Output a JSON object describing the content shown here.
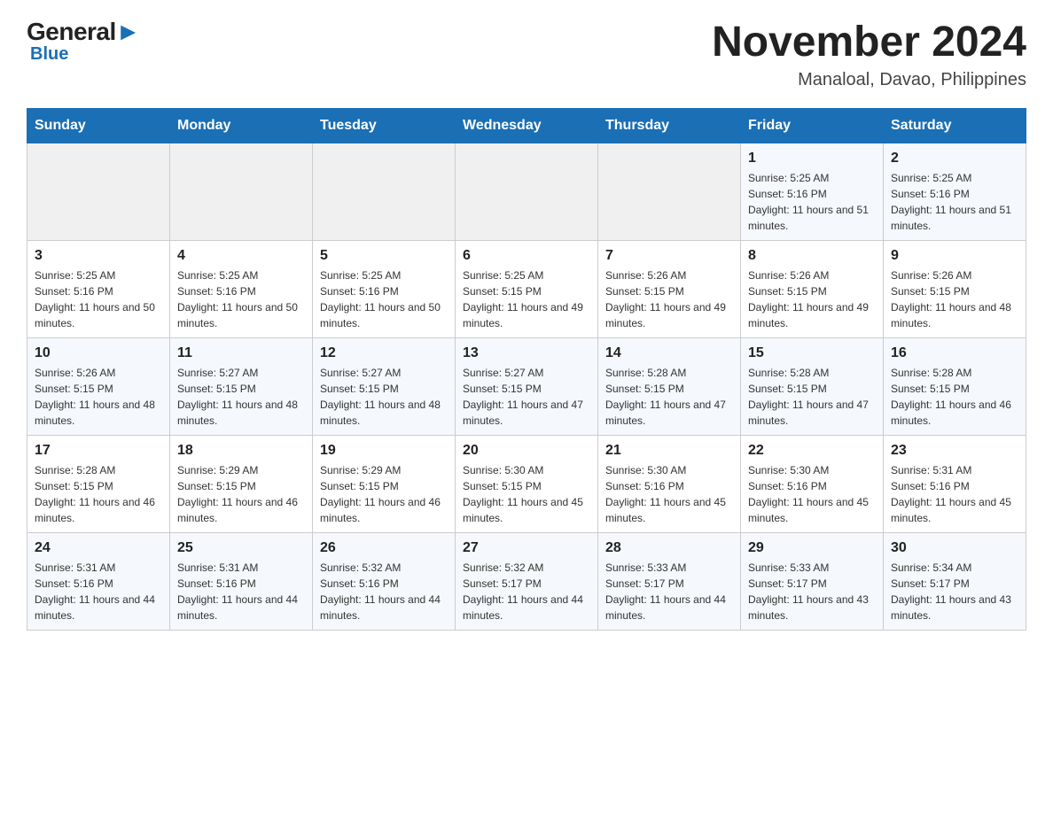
{
  "header": {
    "logo_general": "General",
    "logo_blue": "Blue",
    "month_title": "November 2024",
    "location": "Manaloal, Davao, Philippines"
  },
  "days_of_week": [
    "Sunday",
    "Monday",
    "Tuesday",
    "Wednesday",
    "Thursday",
    "Friday",
    "Saturday"
  ],
  "weeks": [
    [
      {
        "day": "",
        "info": ""
      },
      {
        "day": "",
        "info": ""
      },
      {
        "day": "",
        "info": ""
      },
      {
        "day": "",
        "info": ""
      },
      {
        "day": "",
        "info": ""
      },
      {
        "day": "1",
        "info": "Sunrise: 5:25 AM\nSunset: 5:16 PM\nDaylight: 11 hours and 51 minutes."
      },
      {
        "day": "2",
        "info": "Sunrise: 5:25 AM\nSunset: 5:16 PM\nDaylight: 11 hours and 51 minutes."
      }
    ],
    [
      {
        "day": "3",
        "info": "Sunrise: 5:25 AM\nSunset: 5:16 PM\nDaylight: 11 hours and 50 minutes."
      },
      {
        "day": "4",
        "info": "Sunrise: 5:25 AM\nSunset: 5:16 PM\nDaylight: 11 hours and 50 minutes."
      },
      {
        "day": "5",
        "info": "Sunrise: 5:25 AM\nSunset: 5:16 PM\nDaylight: 11 hours and 50 minutes."
      },
      {
        "day": "6",
        "info": "Sunrise: 5:25 AM\nSunset: 5:15 PM\nDaylight: 11 hours and 49 minutes."
      },
      {
        "day": "7",
        "info": "Sunrise: 5:26 AM\nSunset: 5:15 PM\nDaylight: 11 hours and 49 minutes."
      },
      {
        "day": "8",
        "info": "Sunrise: 5:26 AM\nSunset: 5:15 PM\nDaylight: 11 hours and 49 minutes."
      },
      {
        "day": "9",
        "info": "Sunrise: 5:26 AM\nSunset: 5:15 PM\nDaylight: 11 hours and 48 minutes."
      }
    ],
    [
      {
        "day": "10",
        "info": "Sunrise: 5:26 AM\nSunset: 5:15 PM\nDaylight: 11 hours and 48 minutes."
      },
      {
        "day": "11",
        "info": "Sunrise: 5:27 AM\nSunset: 5:15 PM\nDaylight: 11 hours and 48 minutes."
      },
      {
        "day": "12",
        "info": "Sunrise: 5:27 AM\nSunset: 5:15 PM\nDaylight: 11 hours and 48 minutes."
      },
      {
        "day": "13",
        "info": "Sunrise: 5:27 AM\nSunset: 5:15 PM\nDaylight: 11 hours and 47 minutes."
      },
      {
        "day": "14",
        "info": "Sunrise: 5:28 AM\nSunset: 5:15 PM\nDaylight: 11 hours and 47 minutes."
      },
      {
        "day": "15",
        "info": "Sunrise: 5:28 AM\nSunset: 5:15 PM\nDaylight: 11 hours and 47 minutes."
      },
      {
        "day": "16",
        "info": "Sunrise: 5:28 AM\nSunset: 5:15 PM\nDaylight: 11 hours and 46 minutes."
      }
    ],
    [
      {
        "day": "17",
        "info": "Sunrise: 5:28 AM\nSunset: 5:15 PM\nDaylight: 11 hours and 46 minutes."
      },
      {
        "day": "18",
        "info": "Sunrise: 5:29 AM\nSunset: 5:15 PM\nDaylight: 11 hours and 46 minutes."
      },
      {
        "day": "19",
        "info": "Sunrise: 5:29 AM\nSunset: 5:15 PM\nDaylight: 11 hours and 46 minutes."
      },
      {
        "day": "20",
        "info": "Sunrise: 5:30 AM\nSunset: 5:15 PM\nDaylight: 11 hours and 45 minutes."
      },
      {
        "day": "21",
        "info": "Sunrise: 5:30 AM\nSunset: 5:16 PM\nDaylight: 11 hours and 45 minutes."
      },
      {
        "day": "22",
        "info": "Sunrise: 5:30 AM\nSunset: 5:16 PM\nDaylight: 11 hours and 45 minutes."
      },
      {
        "day": "23",
        "info": "Sunrise: 5:31 AM\nSunset: 5:16 PM\nDaylight: 11 hours and 45 minutes."
      }
    ],
    [
      {
        "day": "24",
        "info": "Sunrise: 5:31 AM\nSunset: 5:16 PM\nDaylight: 11 hours and 44 minutes."
      },
      {
        "day": "25",
        "info": "Sunrise: 5:31 AM\nSunset: 5:16 PM\nDaylight: 11 hours and 44 minutes."
      },
      {
        "day": "26",
        "info": "Sunrise: 5:32 AM\nSunset: 5:16 PM\nDaylight: 11 hours and 44 minutes."
      },
      {
        "day": "27",
        "info": "Sunrise: 5:32 AM\nSunset: 5:17 PM\nDaylight: 11 hours and 44 minutes."
      },
      {
        "day": "28",
        "info": "Sunrise: 5:33 AM\nSunset: 5:17 PM\nDaylight: 11 hours and 44 minutes."
      },
      {
        "day": "29",
        "info": "Sunrise: 5:33 AM\nSunset: 5:17 PM\nDaylight: 11 hours and 43 minutes."
      },
      {
        "day": "30",
        "info": "Sunrise: 5:34 AM\nSunset: 5:17 PM\nDaylight: 11 hours and 43 minutes."
      }
    ]
  ]
}
